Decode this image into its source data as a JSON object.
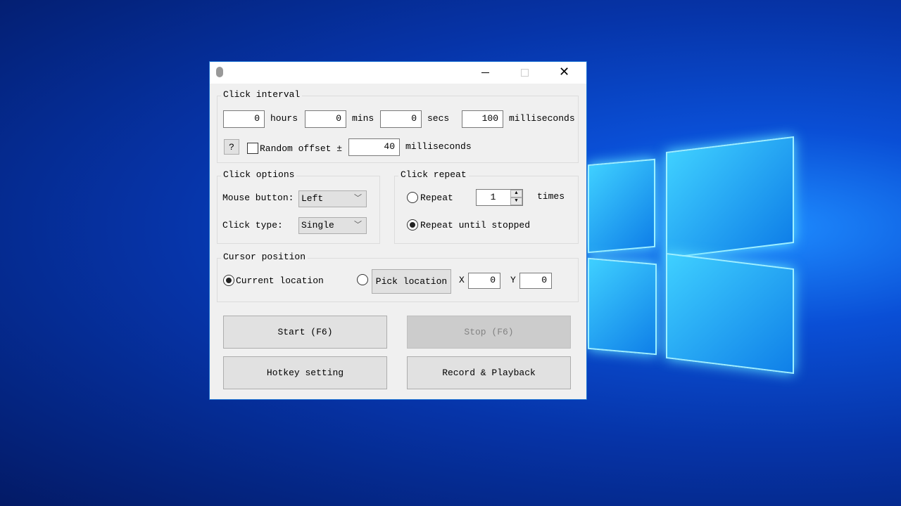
{
  "window": {
    "minimize_icon": "minimize-icon",
    "maximize_icon": "maximize-icon",
    "close_icon": "close-icon",
    "app_icon": "mouse-icon"
  },
  "click_interval": {
    "legend": "Click interval",
    "hours": "0",
    "hours_label": "hours",
    "mins": "0",
    "mins_label": "mins",
    "secs": "0",
    "secs_label": "secs",
    "ms": "100",
    "ms_label": "milliseconds",
    "help_label": "?",
    "random_offset_label": "Random offset ±",
    "random_offset_checked": false,
    "offset": "40",
    "offset_label": "milliseconds"
  },
  "click_options": {
    "legend": "Click options",
    "mouse_button_label": "Mouse button:",
    "mouse_button": "Left",
    "click_type_label": "Click type:",
    "click_type": "Single"
  },
  "click_repeat": {
    "legend": "Click repeat",
    "repeat_label": "Repeat",
    "repeat_count": "1",
    "times_label": "times",
    "until_stopped_label": "Repeat until stopped",
    "selected": "until_stopped"
  },
  "cursor_position": {
    "legend": "Cursor position",
    "current_label": "Current location",
    "pick_label": "Pick location",
    "x_label": "X",
    "x": "0",
    "y_label": "Y",
    "y": "0",
    "selected": "current"
  },
  "buttons": {
    "start": "Start (F6)",
    "stop": "Stop (F6)",
    "hotkey": "Hotkey setting",
    "record": "Record & Playback"
  }
}
